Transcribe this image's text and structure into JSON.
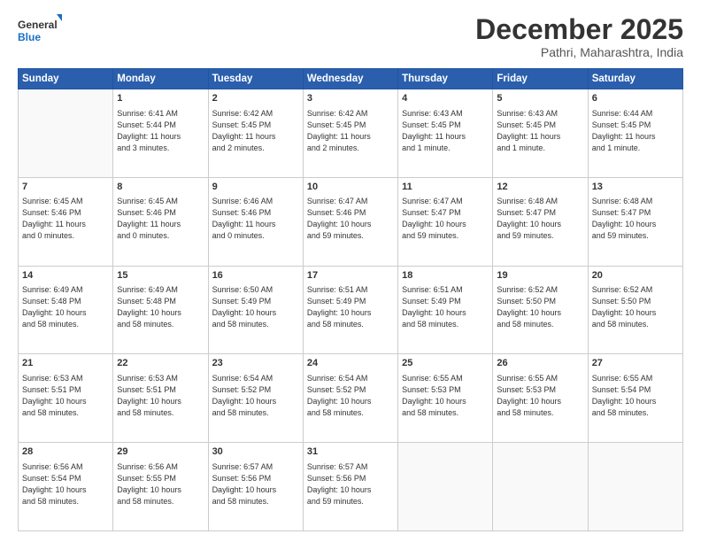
{
  "header": {
    "logo_general": "General",
    "logo_blue": "Blue",
    "month_title": "December 2025",
    "location": "Pathri, Maharashtra, India"
  },
  "days_of_week": [
    "Sunday",
    "Monday",
    "Tuesday",
    "Wednesday",
    "Thursday",
    "Friday",
    "Saturday"
  ],
  "weeks": [
    [
      {
        "day": "",
        "info": ""
      },
      {
        "day": "1",
        "info": "Sunrise: 6:41 AM\nSunset: 5:44 PM\nDaylight: 11 hours\nand 3 minutes."
      },
      {
        "day": "2",
        "info": "Sunrise: 6:42 AM\nSunset: 5:45 PM\nDaylight: 11 hours\nand 2 minutes."
      },
      {
        "day": "3",
        "info": "Sunrise: 6:42 AM\nSunset: 5:45 PM\nDaylight: 11 hours\nand 2 minutes."
      },
      {
        "day": "4",
        "info": "Sunrise: 6:43 AM\nSunset: 5:45 PM\nDaylight: 11 hours\nand 1 minute."
      },
      {
        "day": "5",
        "info": "Sunrise: 6:43 AM\nSunset: 5:45 PM\nDaylight: 11 hours\nand 1 minute."
      },
      {
        "day": "6",
        "info": "Sunrise: 6:44 AM\nSunset: 5:45 PM\nDaylight: 11 hours\nand 1 minute."
      }
    ],
    [
      {
        "day": "7",
        "info": "Sunrise: 6:45 AM\nSunset: 5:46 PM\nDaylight: 11 hours\nand 0 minutes."
      },
      {
        "day": "8",
        "info": "Sunrise: 6:45 AM\nSunset: 5:46 PM\nDaylight: 11 hours\nand 0 minutes."
      },
      {
        "day": "9",
        "info": "Sunrise: 6:46 AM\nSunset: 5:46 PM\nDaylight: 11 hours\nand 0 minutes."
      },
      {
        "day": "10",
        "info": "Sunrise: 6:47 AM\nSunset: 5:46 PM\nDaylight: 10 hours\nand 59 minutes."
      },
      {
        "day": "11",
        "info": "Sunrise: 6:47 AM\nSunset: 5:47 PM\nDaylight: 10 hours\nand 59 minutes."
      },
      {
        "day": "12",
        "info": "Sunrise: 6:48 AM\nSunset: 5:47 PM\nDaylight: 10 hours\nand 59 minutes."
      },
      {
        "day": "13",
        "info": "Sunrise: 6:48 AM\nSunset: 5:47 PM\nDaylight: 10 hours\nand 59 minutes."
      }
    ],
    [
      {
        "day": "14",
        "info": "Sunrise: 6:49 AM\nSunset: 5:48 PM\nDaylight: 10 hours\nand 58 minutes."
      },
      {
        "day": "15",
        "info": "Sunrise: 6:49 AM\nSunset: 5:48 PM\nDaylight: 10 hours\nand 58 minutes."
      },
      {
        "day": "16",
        "info": "Sunrise: 6:50 AM\nSunset: 5:49 PM\nDaylight: 10 hours\nand 58 minutes."
      },
      {
        "day": "17",
        "info": "Sunrise: 6:51 AM\nSunset: 5:49 PM\nDaylight: 10 hours\nand 58 minutes."
      },
      {
        "day": "18",
        "info": "Sunrise: 6:51 AM\nSunset: 5:49 PM\nDaylight: 10 hours\nand 58 minutes."
      },
      {
        "day": "19",
        "info": "Sunrise: 6:52 AM\nSunset: 5:50 PM\nDaylight: 10 hours\nand 58 minutes."
      },
      {
        "day": "20",
        "info": "Sunrise: 6:52 AM\nSunset: 5:50 PM\nDaylight: 10 hours\nand 58 minutes."
      }
    ],
    [
      {
        "day": "21",
        "info": "Sunrise: 6:53 AM\nSunset: 5:51 PM\nDaylight: 10 hours\nand 58 minutes."
      },
      {
        "day": "22",
        "info": "Sunrise: 6:53 AM\nSunset: 5:51 PM\nDaylight: 10 hours\nand 58 minutes."
      },
      {
        "day": "23",
        "info": "Sunrise: 6:54 AM\nSunset: 5:52 PM\nDaylight: 10 hours\nand 58 minutes."
      },
      {
        "day": "24",
        "info": "Sunrise: 6:54 AM\nSunset: 5:52 PM\nDaylight: 10 hours\nand 58 minutes."
      },
      {
        "day": "25",
        "info": "Sunrise: 6:55 AM\nSunset: 5:53 PM\nDaylight: 10 hours\nand 58 minutes."
      },
      {
        "day": "26",
        "info": "Sunrise: 6:55 AM\nSunset: 5:53 PM\nDaylight: 10 hours\nand 58 minutes."
      },
      {
        "day": "27",
        "info": "Sunrise: 6:55 AM\nSunset: 5:54 PM\nDaylight: 10 hours\nand 58 minutes."
      }
    ],
    [
      {
        "day": "28",
        "info": "Sunrise: 6:56 AM\nSunset: 5:54 PM\nDaylight: 10 hours\nand 58 minutes."
      },
      {
        "day": "29",
        "info": "Sunrise: 6:56 AM\nSunset: 5:55 PM\nDaylight: 10 hours\nand 58 minutes."
      },
      {
        "day": "30",
        "info": "Sunrise: 6:57 AM\nSunset: 5:56 PM\nDaylight: 10 hours\nand 58 minutes."
      },
      {
        "day": "31",
        "info": "Sunrise: 6:57 AM\nSunset: 5:56 PM\nDaylight: 10 hours\nand 59 minutes."
      },
      {
        "day": "",
        "info": ""
      },
      {
        "day": "",
        "info": ""
      },
      {
        "day": "",
        "info": ""
      }
    ]
  ]
}
